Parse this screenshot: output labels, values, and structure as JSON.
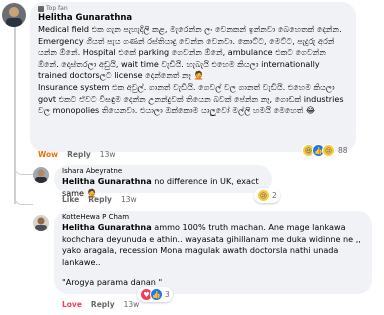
{
  "top_comment": {
    "badge": "Top fan",
    "author": "Helitha Gunarathna",
    "text": "Medical field එක ගැන පැහැදිලි කළ, මැරෙන්න ලං වෙනකන් ඉන්නවා බෙහෙතක් දෙන්න. Emergency ගියත් පැය ගණන් රස්තියාදු වෙන්න වෙනවා. කොට්ට, මෙට්ට, පැදුරු අරන් යන්න ඕනේ. Hospital එකේ parking ගෙවන්න ඕනේ, ambulance එකට ගෙවන්න ඕනේ. දොස්තරලා අඩුයි, wait time වැඩියි. හැබැයි එහෙම කියලා internationally trained doctorsලට license දෙන්නෙත් නෑ 🤦",
    "text2": "Insurance system එක අවුල්. ගානත් වැඩියි. ගෙවල් වල ගානත් වැඩියි. එහෙම කියලා govt එකට ඒවට විසඳුම දෙන්න උනන්දුවක් තියෙන බවක් පේන්න නෑ, ගොඩක් industries වල monopolies තියෙනවා. එයාලා ඔක්කොම යාලුවෝ මල්ලි හමයි මෙහෙත් 😂",
    "actions": {
      "wow": "Wow",
      "reply": "Reply",
      "time": "13w"
    },
    "reactions_count": "88"
  },
  "replies": [
    {
      "author": "Ishara Abeyratne",
      "mention": "Helitha Gunarathna",
      "text": " no difference in UK, exact same 🤦",
      "actions": {
        "like": "Like",
        "reply": "Reply",
        "time": "13w"
      },
      "reactions_count": "2"
    },
    {
      "author": "KotteHewa P Cham",
      "mention": "Helitha Gunarathna",
      "text": " ammo 100% truth machan. Ane mage lankawa kochchara deyunuda e athin.. wayasata gihillanam me duka widinne ne ,, yako aragala, recession Mona magulak awath doctorsla nathi unada lankawe..",
      "text2": "\"Arogya parama danan \"",
      "actions": {
        "love": "Love",
        "reply": "Reply",
        "time": "13w"
      },
      "reactions_count": "3"
    }
  ],
  "colors": {
    "bubble": "#f0f2f5",
    "wow": "#e9710f",
    "love": "#f33e58",
    "meta": "#65676b"
  }
}
